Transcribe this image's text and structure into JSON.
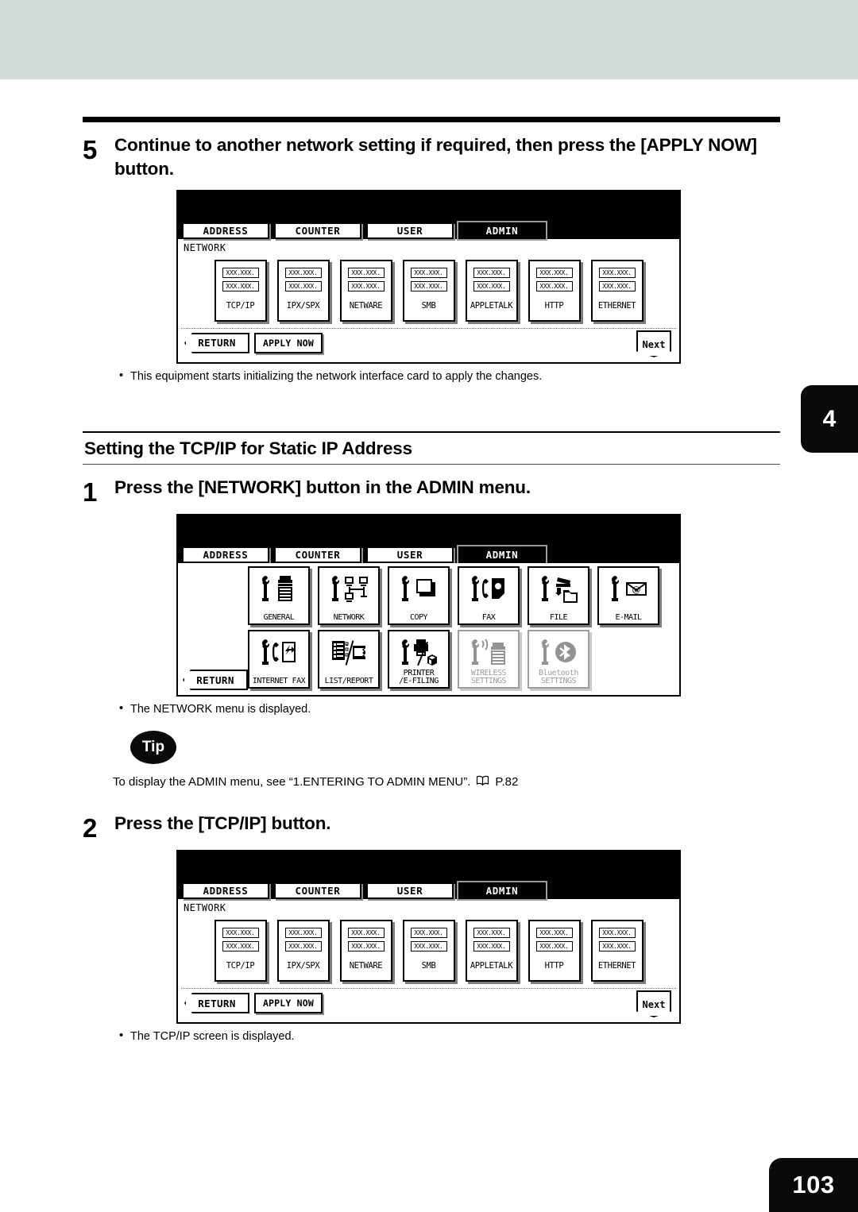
{
  "document": {
    "page_number": "103",
    "chapter_tab": "4"
  },
  "steps": [
    {
      "number": "5",
      "text": "Continue to another network setting if required, then press the [APPLY NOW] button.",
      "note": "This equipment starts initializing the network interface card to apply the changes."
    },
    {
      "number": "1",
      "text": "Press the [NETWORK] button in the ADMIN menu.",
      "note": "The NETWORK menu is displayed."
    },
    {
      "number": "2",
      "text": "Press the [TCP/IP] button.",
      "note": "The TCP/IP screen is displayed."
    }
  ],
  "section_heading": "Setting the TCP/IP for Static IP Address",
  "tip": {
    "badge": "Tip",
    "text": "To display the ADMIN menu, see “1.ENTERING TO ADMIN MENU”.",
    "reference": "P.82",
    "book_icon": "book-icon"
  },
  "lcd": {
    "tabs": [
      {
        "label": "ADDRESS",
        "selected": false
      },
      {
        "label": "COUNTER",
        "selected": false
      },
      {
        "label": "USER",
        "selected": false
      },
      {
        "label": "ADMIN",
        "selected": true
      }
    ],
    "network_screen": {
      "breadcrumb": "NETWORK",
      "ip_placeholder_top": "XXX.XXX.",
      "ip_placeholder_bottom": "XXX.XXX.",
      "buttons": [
        {
          "label": "TCP/IP"
        },
        {
          "label": "IPX/SPX"
        },
        {
          "label": "NETWARE"
        },
        {
          "label": "SMB"
        },
        {
          "label": "APPLETALK"
        },
        {
          "label": "HTTP"
        },
        {
          "label": "ETHERNET"
        }
      ],
      "return_label": "RETURN",
      "apply_label": "APPLY NOW",
      "next_label": "Next"
    },
    "admin_menu": {
      "return_label": "RETURN",
      "row1": [
        {
          "label": "GENERAL",
          "icon": "wrench-printer-icon",
          "disabled": false
        },
        {
          "label": "NETWORK",
          "icon": "wrench-network-icon",
          "disabled": false
        },
        {
          "label": "COPY",
          "icon": "wrench-copy-icon",
          "disabled": false
        },
        {
          "label": "FAX",
          "icon": "wrench-fax-icon",
          "disabled": false
        },
        {
          "label": "FILE",
          "icon": "wrench-file-icon",
          "disabled": false
        },
        {
          "label": "E-MAIL",
          "icon": "wrench-email-icon",
          "disabled": false
        }
      ],
      "row2": [
        {
          "label": "INTERNET FAX",
          "icon": "wrench-internet-fax-icon",
          "disabled": false
        },
        {
          "label": "LIST/REPORT",
          "icon": "list-report-icon",
          "disabled": false
        },
        {
          "label": "PRINTER\n/E-FILING",
          "icon": "wrench-printer-efiling-icon",
          "disabled": false
        },
        {
          "label": "WIRELESS\nSETTINGS",
          "icon": "wrench-wireless-icon",
          "disabled": true
        },
        {
          "label": "Bluetooth\nSETTINGS",
          "icon": "wrench-bluetooth-icon",
          "disabled": true
        }
      ]
    }
  },
  "colors": {
    "top_band": "#d2dbd9",
    "ink": "#000000",
    "disabled": "#9d9d9d"
  }
}
